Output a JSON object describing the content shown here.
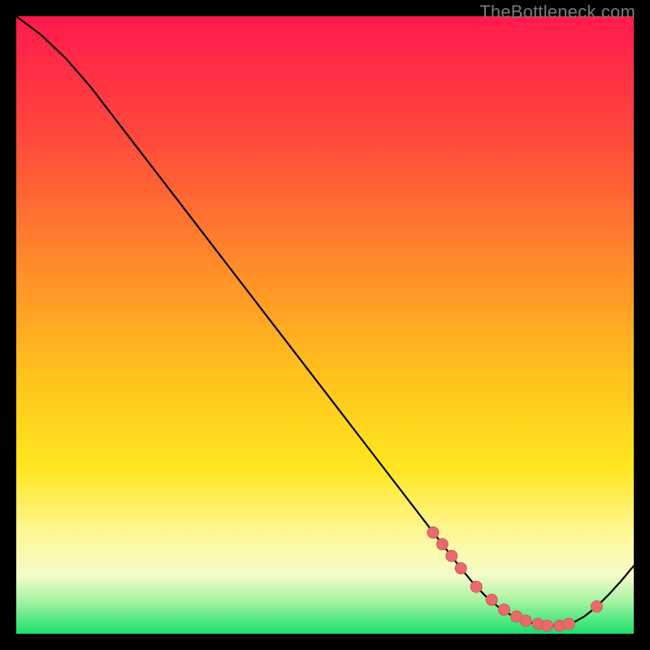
{
  "watermark": "TheBottleneck.com",
  "colors": {
    "bg": "#000000",
    "curve": "#000000",
    "dot_fill": "#e96a6b",
    "dot_stroke": "#cf5a5b",
    "gradient_stops": [
      {
        "offset": 0.0,
        "color": "#ff1a4d"
      },
      {
        "offset": 0.2,
        "color": "#ff4a3b"
      },
      {
        "offset": 0.4,
        "color": "#ff8a2a"
      },
      {
        "offset": 0.58,
        "color": "#ffc21e"
      },
      {
        "offset": 0.73,
        "color": "#ffe61e"
      },
      {
        "offset": 0.84,
        "color": "#fff89a"
      },
      {
        "offset": 0.905,
        "color": "#f6fcc9"
      },
      {
        "offset": 0.95,
        "color": "#9ff2a0"
      },
      {
        "offset": 1.0,
        "color": "#18e06a"
      }
    ]
  },
  "chart_data": {
    "type": "line",
    "title": "",
    "xlabel": "",
    "ylabel": "",
    "xlim": [
      0,
      100
    ],
    "ylim": [
      0,
      100
    ],
    "series": [
      {
        "name": "bottleneck-curve",
        "x": [
          0,
          4,
          8,
          12,
          16,
          20,
          24,
          28,
          32,
          36,
          40,
          44,
          48,
          52,
          56,
          60,
          64,
          68,
          70,
          72,
          74,
          76,
          78,
          80,
          82,
          84,
          86,
          88,
          90,
          92,
          94,
          96,
          98,
          100
        ],
        "y": [
          100,
          97,
          93.2,
          88.6,
          83.4,
          78.2,
          73.0,
          67.8,
          62.6,
          57.4,
          52.2,
          47.0,
          41.8,
          36.6,
          31.4,
          26.2,
          21.0,
          15.8,
          13.2,
          10.6,
          8.2,
          6.1,
          4.4,
          3.1,
          2.2,
          1.6,
          1.3,
          1.3,
          1.7,
          2.8,
          4.4,
          6.4,
          8.6,
          11.0
        ]
      }
    ],
    "markers": {
      "name": "highlighted-range",
      "x": [
        67.5,
        69.0,
        70.5,
        72.0,
        74.5,
        77.0,
        79.0,
        81.0,
        82.5,
        84.5,
        86.0,
        88.0,
        89.5,
        94.0
      ],
      "y": [
        16.4,
        14.5,
        12.6,
        10.6,
        7.6,
        5.5,
        3.9,
        2.8,
        2.1,
        1.6,
        1.3,
        1.3,
        1.6,
        4.4
      ]
    }
  }
}
